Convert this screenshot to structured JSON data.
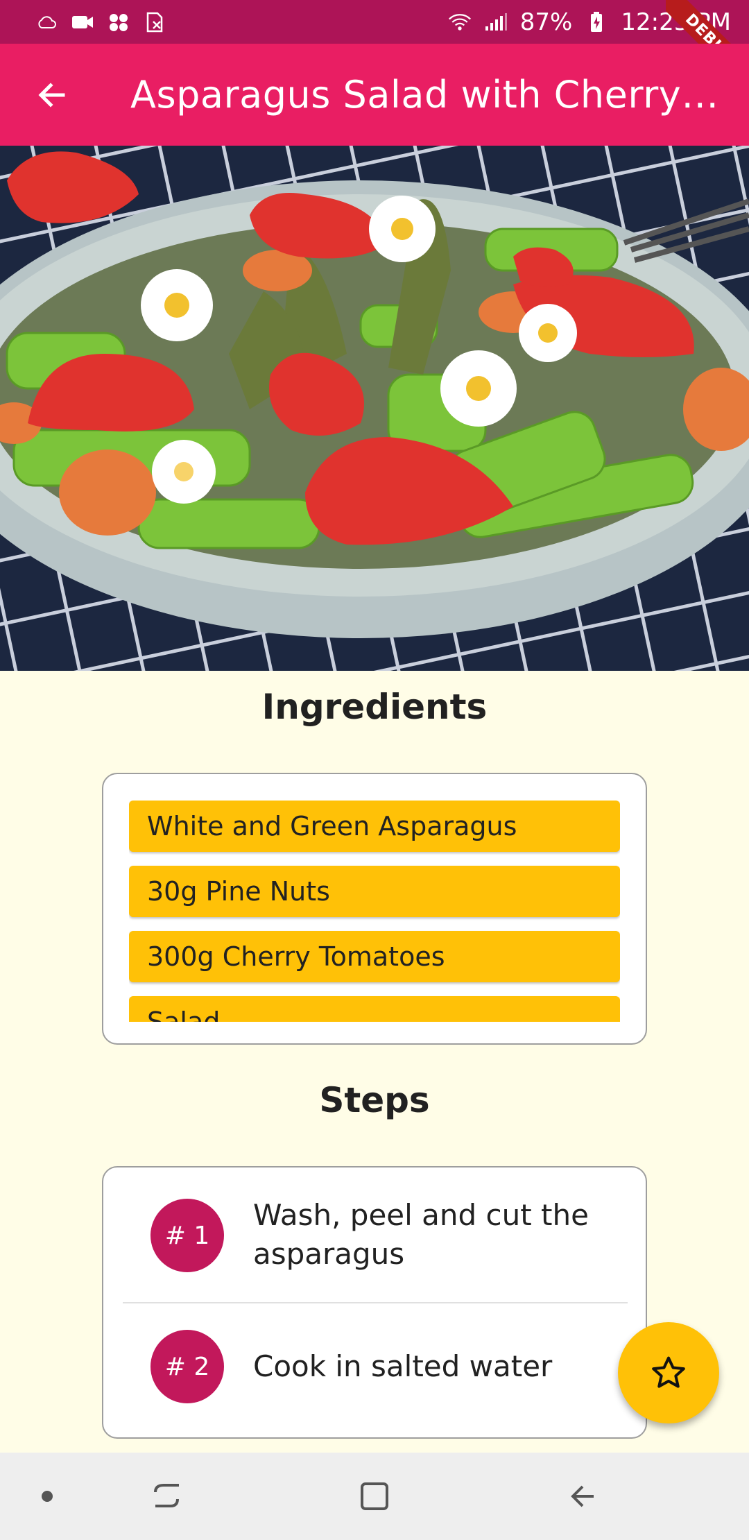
{
  "status_bar": {
    "battery": "87%",
    "time": "12:25 PM",
    "debug_label": "DEBUG"
  },
  "app_bar": {
    "title": "Asparagus Salad with Cherry Tomatoes"
  },
  "ingredients": {
    "heading": "Ingredients",
    "items": [
      "White and Green Asparagus",
      "30g Pine Nuts",
      "300g Cherry Tomatoes",
      "Salad"
    ]
  },
  "steps": {
    "heading": "Steps",
    "items": [
      {
        "badge": "# 1",
        "text": "Wash, peel and cut the asparagus"
      },
      {
        "badge": "# 2",
        "text": "Cook in salted water"
      }
    ]
  },
  "colors": {
    "status_bar": "#AD1457",
    "app_bar": "#E91E63",
    "background": "#FFFDE7",
    "ingredient_chip": "#FFC107",
    "step_badge": "#C2185B",
    "fab": "#FFC107"
  },
  "icons": {
    "back": "arrow-left-icon",
    "fab": "star-outline-icon",
    "nav_recents": "recents-icon",
    "nav_home": "home-square-icon",
    "nav_back": "nav-back-icon"
  }
}
